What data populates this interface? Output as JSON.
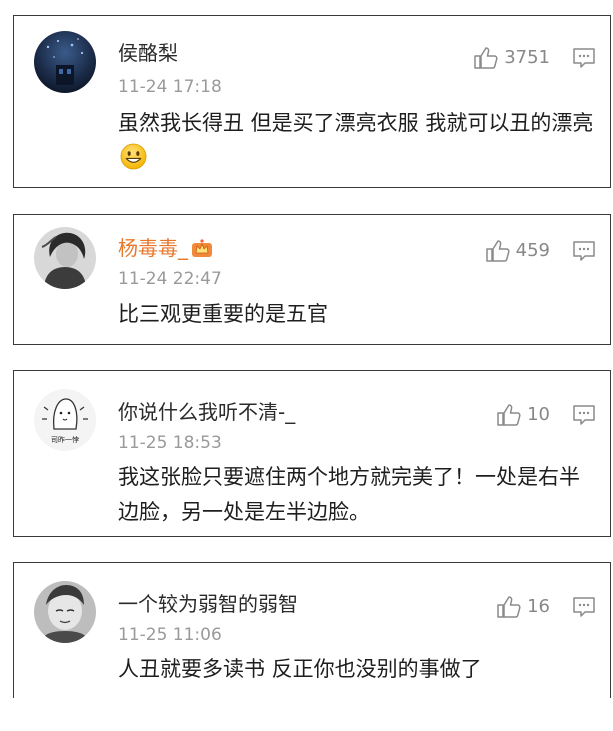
{
  "comments": [
    {
      "username": "侯酪梨",
      "timestamp": "11-24 17:18",
      "likes": "3751",
      "text": "虽然我长得丑 但是买了漂亮衣服 我就可以丑的漂亮",
      "trailing_emoji": "grinning-face-emoji"
    },
    {
      "username": "杨毒毒_",
      "username_badge": "crown-badge-icon",
      "timestamp": "11-24 22:47",
      "likes": "459",
      "text": "比三观更重要的是五官"
    },
    {
      "username": "你说什么我听不清-_",
      "avatar_text": "司昨一悖",
      "timestamp": "11-25 18:53",
      "likes": "10",
      "text": "我这张脸只要遮住两个地方就完美了！一处是右半边脸，另一处是左半边脸。"
    },
    {
      "username": "一个较为弱智的弱智",
      "timestamp": "11-25 11:06",
      "likes": "16",
      "text": "人丑就要多读书 反正你也没别的事做了"
    }
  ],
  "colors": {
    "username": "#2b2b2b",
    "username_highlight": "#e8782b",
    "timestamp": "#9a9a9a",
    "icon": "#888888",
    "border": "#3a3a3a"
  }
}
